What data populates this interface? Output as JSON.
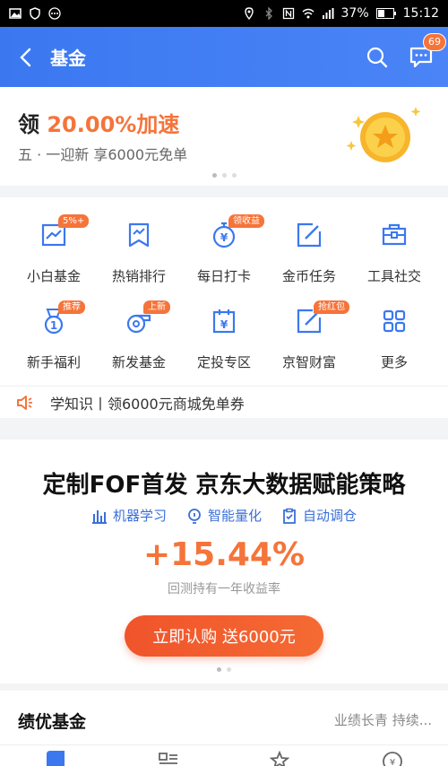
{
  "status_bar": {
    "battery_pct": "37%",
    "time": "15:12"
  },
  "header": {
    "title": "基金",
    "message_badge": "69"
  },
  "promo": {
    "title_prefix": "领 ",
    "title_highlight": "20.00%加速",
    "subtitle": "五 · 一迎新 享6000元免单"
  },
  "menu": {
    "items": [
      {
        "label": "小白基金",
        "tag": "5%+",
        "icon": "chart-icon"
      },
      {
        "label": "热销排行",
        "tag": "",
        "icon": "trend-flag-icon"
      },
      {
        "label": "每日打卡",
        "tag": "领收益",
        "icon": "stopwatch-coin-icon"
      },
      {
        "label": "金币任务",
        "tag": "",
        "icon": "edit-icon"
      },
      {
        "label": "工具社交",
        "tag": "",
        "icon": "toolbox-icon"
      },
      {
        "label": "新手福利",
        "tag": "推荐",
        "icon": "medal-icon"
      },
      {
        "label": "新发基金",
        "tag": "上新",
        "icon": "whistle-icon"
      },
      {
        "label": "定投专区",
        "tag": "",
        "icon": "calendar-coin-icon"
      },
      {
        "label": "京智财富",
        "tag": "抢红包",
        "icon": "edit-icon"
      },
      {
        "label": "更多",
        "tag": "",
        "icon": "grid-icon"
      }
    ]
  },
  "notice": {
    "text": "学知识丨领6000元商城免单券"
  },
  "banner": {
    "title": "定制FOF首发 京东大数据赋能策略",
    "features": [
      "机器学习",
      "智能量化",
      "自动调仓"
    ],
    "return_pct": "+15.44%",
    "return_label": "回测持有一年收益率",
    "button_label": "立即认购 送6000元"
  },
  "section": {
    "title": "绩优基金",
    "subtitle": "业绩长青 持续..."
  },
  "colors": {
    "brand_blue": "#3b78f0",
    "accent_orange": "#f5743a"
  }
}
